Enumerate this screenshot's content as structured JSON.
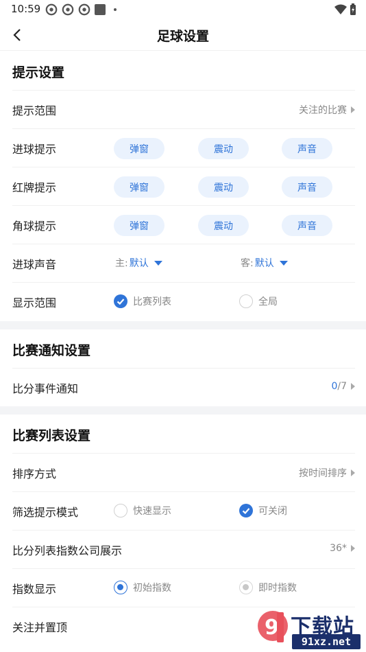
{
  "status_bar": {
    "time": "10:59"
  },
  "header": {
    "title": "足球设置"
  },
  "sections": {
    "tips": {
      "title": "提示设置",
      "scope": {
        "label": "提示范围",
        "value": "关注的比赛"
      },
      "goal_tip": {
        "label": "进球提示",
        "options": [
          "弹窗",
          "震动",
          "声音"
        ]
      },
      "red_card_tip": {
        "label": "红牌提示",
        "options": [
          "弹窗",
          "震动",
          "声音"
        ]
      },
      "corner_tip": {
        "label": "角球提示",
        "options": [
          "弹窗",
          "震动",
          "声音"
        ]
      },
      "goal_sound": {
        "label": "进球声音",
        "home_key": "主:",
        "home_value": "默认",
        "away_key": "客:",
        "away_value": "默认"
      },
      "display_scope": {
        "label": "显示范围",
        "option_a": "比赛列表",
        "option_b": "全局",
        "selected": "比赛列表"
      }
    },
    "notify": {
      "title": "比赛通知设置",
      "score_event": {
        "label": "比分事件通知",
        "count_now": "0",
        "count_total": "/7"
      }
    },
    "list": {
      "title": "比赛列表设置",
      "sort": {
        "label": "排序方式",
        "value": "按时间排序"
      },
      "filter_mode": {
        "label": "筛选提示模式",
        "option_a": "快速显示",
        "option_b": "可关闭",
        "selected": "可关闭"
      },
      "index_company": {
        "label": "比分列表指数公司展示",
        "value": "36*"
      },
      "index_display": {
        "label": "指数显示",
        "option_a": "初始指数",
        "option_b": "即时指数",
        "selected": "初始指数"
      },
      "follow_top": {
        "label": "关注并置顶"
      }
    }
  },
  "watermark": {
    "brand": "下载站",
    "domain": "91xz.net"
  },
  "colors": {
    "accent": "#2f74d8",
    "pill_bg": "#eaf2fd",
    "band": "#f3f4f6"
  }
}
